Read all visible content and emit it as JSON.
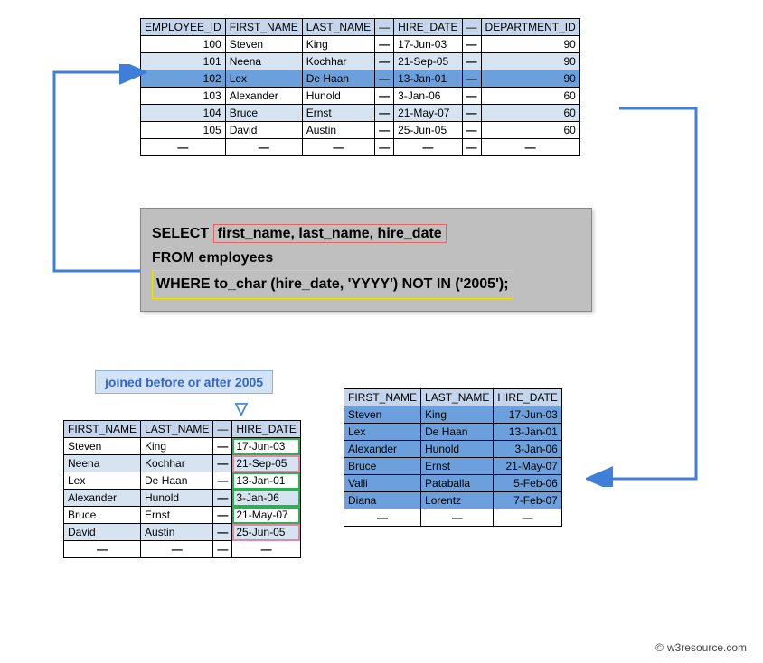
{
  "top_table": {
    "headers": [
      "EMPLOYEE_ID",
      "FIRST_NAME",
      "LAST_NAME",
      "—",
      "HIRE_DATE",
      "—",
      "DEPARTMENT_ID"
    ],
    "rows": [
      {
        "emp": "100",
        "fn": "Steven",
        "ln": "King",
        "hd": "17-Jun-03",
        "dep": "90",
        "hl": ""
      },
      {
        "emp": "101",
        "fn": "Neena",
        "ln": "Kochhar",
        "hd": "21-Sep-05",
        "dep": "90",
        "hl": "light"
      },
      {
        "emp": "102",
        "fn": "Lex",
        "ln": "De Haan",
        "hd": "13-Jan-01",
        "dep": "90",
        "hl": "mid"
      },
      {
        "emp": "103",
        "fn": "Alexander",
        "ln": "Hunold",
        "hd": "3-Jan-06",
        "dep": "60",
        "hl": ""
      },
      {
        "emp": "104",
        "fn": "Bruce",
        "ln": "Ernst",
        "hd": "21-May-07",
        "dep": "60",
        "hl": "light"
      },
      {
        "emp": "105",
        "fn": "David",
        "ln": "Austin",
        "hd": "25-Jun-05",
        "dep": "60",
        "hl": ""
      }
    ]
  },
  "sql": {
    "select": "SELECT",
    "cols": "first_name, last_name, hire_date",
    "from": "FROM employees",
    "where": "WHERE to_char (hire_date, 'YYYY') NOT IN ('2005');"
  },
  "label": "joined before or after 2005",
  "lower_left": {
    "headers": [
      "FIRST_NAME",
      "LAST_NAME",
      "—",
      "HIRE_DATE"
    ],
    "rows": [
      {
        "fn": "Steven",
        "ln": "King",
        "hd": "17-Jun-03",
        "cls": "green"
      },
      {
        "fn": "Neena",
        "ln": "Kochhar",
        "hd": "21-Sep-05",
        "cls": "pink"
      },
      {
        "fn": "Lex",
        "ln": "De Haan",
        "hd": "13-Jan-01",
        "cls": "green"
      },
      {
        "fn": "Alexander",
        "ln": "Hunold",
        "hd": "3-Jan-06",
        "cls": "green"
      },
      {
        "fn": "Bruce",
        "ln": "Ernst",
        "hd": "21-May-07",
        "cls": "green"
      },
      {
        "fn": "David",
        "ln": "Austin",
        "hd": "25-Jun-05",
        "cls": "pink"
      }
    ]
  },
  "lower_right": {
    "headers": [
      "FIRST_NAME",
      "LAST_NAME",
      "HIRE_DATE"
    ],
    "rows": [
      {
        "fn": "Steven",
        "ln": "King",
        "hd": "17-Jun-03"
      },
      {
        "fn": "Lex",
        "ln": "De Haan",
        "hd": "13-Jan-01"
      },
      {
        "fn": "Alexander",
        "ln": "Hunold",
        "hd": "3-Jan-06"
      },
      {
        "fn": "Bruce",
        "ln": "Ernst",
        "hd": "21-May-07"
      },
      {
        "fn": "Valli",
        "ln": "Pataballa",
        "hd": "5-Feb-06"
      },
      {
        "fn": "Diana",
        "ln": "Lorentz",
        "hd": "7-Feb-07"
      }
    ]
  },
  "credit": "w3resource.com"
}
